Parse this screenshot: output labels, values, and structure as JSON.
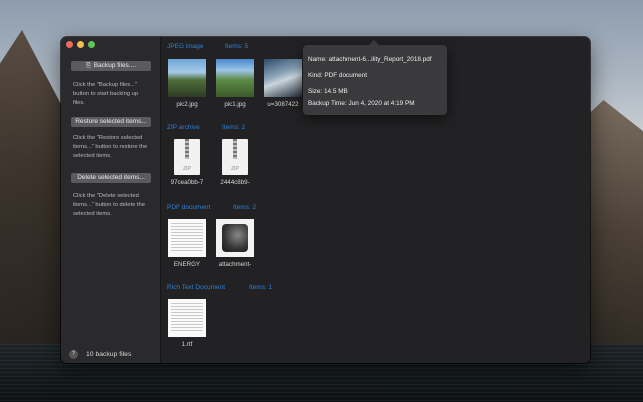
{
  "window": {
    "controls": [
      "close",
      "minimize",
      "zoom"
    ]
  },
  "sidebar": {
    "backup_button": "Backup files....",
    "backup_help": "Click the \"Backup files...\" button to start backing up files.",
    "restore_button": "Restore selected items...",
    "restore_help": "Click the \"Restore selected items...\" button to restore the selected items.",
    "delete_button": "Delete selected items...",
    "delete_help": "Click the \"Delete selected items...\" button to delete the selected items.",
    "footer_help": "?",
    "footer_count": "10 backup files"
  },
  "groups": [
    {
      "title": "JPEG image",
      "count": "Items: 5",
      "items": [
        {
          "label": "pic2.jpg",
          "icon": "photo-thumbnail"
        },
        {
          "label": "pic1.jpg",
          "icon": "photo-thumbnail"
        },
        {
          "label": "u=3087422",
          "icon": "photo-thumbnail"
        }
      ]
    },
    {
      "title": "ZIP archive",
      "count": "Items: 2",
      "items": [
        {
          "label": "97cea0bb-7",
          "icon": "zip-icon",
          "badge": "ZIP"
        },
        {
          "label": "2444c8b9-",
          "icon": "zip-icon",
          "badge": "ZIP"
        }
      ]
    },
    {
      "title": "PDF document",
      "count": "Items: 2",
      "items": [
        {
          "label": "ENERGY",
          "icon": "pdf-thumbnail"
        },
        {
          "label": "attachment-",
          "icon": "pdf-thumbnail"
        }
      ]
    },
    {
      "title": "Rich Text Document",
      "count": "Items: 1",
      "items": [
        {
          "label": "1.rtf",
          "icon": "rtf-thumbnail"
        }
      ]
    }
  ],
  "popover": {
    "name": "Name: attachment-6...ility_Report_2018.pdf",
    "kind": "Kind: PDF document",
    "size": "Size: 14.5 MB",
    "backup_time": "Backup Time: Jun 4, 2020 at 4:19 PM"
  },
  "colors": {
    "accent": "#2f7fd8",
    "window_bg": "#222224",
    "sidebar_bg": "#2a2a2c"
  }
}
